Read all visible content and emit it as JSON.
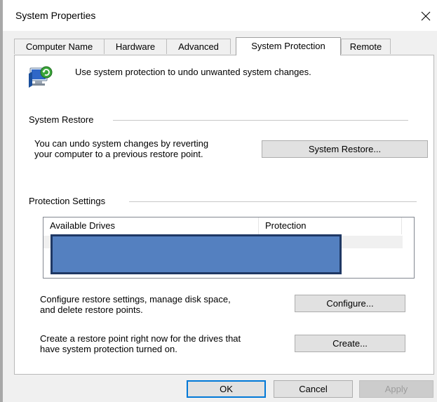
{
  "window": {
    "title": "System Properties",
    "close_icon": "close-icon"
  },
  "tabs": [
    {
      "label": "Computer Name",
      "active": false
    },
    {
      "label": "Hardware",
      "active": false
    },
    {
      "label": "Advanced",
      "active": false
    },
    {
      "label": "System Protection",
      "active": true
    },
    {
      "label": "Remote",
      "active": false
    }
  ],
  "intro": {
    "icon": "system-protection-icon",
    "text": "Use system protection to undo unwanted system changes."
  },
  "system_restore": {
    "group_title": "System Restore",
    "description_line1": "You can undo system changes by reverting",
    "description_line2": "your computer to a previous restore point.",
    "button_label": "System Restore..."
  },
  "protection_settings": {
    "group_title": "Protection Settings",
    "columns": [
      "Available Drives",
      "Protection"
    ],
    "rows_redacted": true,
    "configure_desc_line1": "Configure restore settings, manage disk space,",
    "configure_desc_line2": "and delete restore points.",
    "configure_label": "Configure...",
    "create_desc_line1": "Create a restore point right now for the drives that",
    "create_desc_line2": "have system protection turned on.",
    "create_label": "Create..."
  },
  "footer": {
    "ok_label": "OK",
    "cancel_label": "Cancel",
    "apply_label": "Apply",
    "apply_disabled": true
  },
  "colors": {
    "accent": "#0078d7",
    "redaction_fill": "#5480c0",
    "redaction_border": "#1f3864"
  }
}
